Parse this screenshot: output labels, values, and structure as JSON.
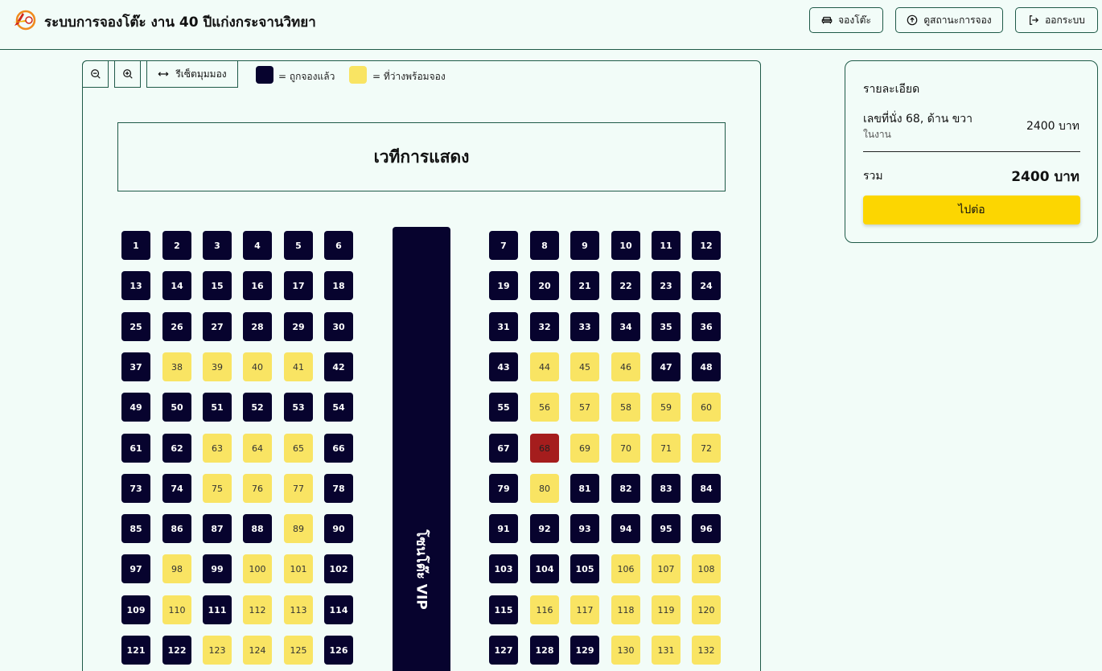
{
  "header": {
    "title": "ระบบการจองโต๊ะ งาน 40 ปีแก่งกระจานวิทยา",
    "buttons": {
      "book": "จองโต๊ะ",
      "status": "ดูสถานะการจอง",
      "logout": "ออกระบบ"
    }
  },
  "toolbar": {
    "reset_label": "รีเซ็ตมุมมอง",
    "legend_booked": "= ถูกจองแล้ว",
    "legend_available": "= ที่ว่างพร้อมจอง"
  },
  "stage_label": "เวทีการแสดง",
  "vip_label": "โซนโต๊ะ VIP",
  "colors": {
    "booked": "#07032e",
    "available": "#f9e463",
    "selected": "#a51d1d",
    "accent": "#fcd601",
    "border": "#1f5a48",
    "background": "#f2fcf8"
  },
  "seats": {
    "available": [
      38,
      39,
      40,
      41,
      44,
      45,
      46,
      56,
      57,
      58,
      59,
      60,
      63,
      64,
      65,
      69,
      70,
      71,
      72,
      75,
      76,
      77,
      80,
      89,
      98,
      100,
      101,
      106,
      107,
      108,
      110,
      112,
      113,
      116,
      117,
      118,
      119,
      120,
      123,
      124,
      125,
      130,
      131,
      132
    ],
    "selected": [
      68
    ],
    "total_visible": 132
  },
  "details": {
    "title": "รายละเอียด",
    "seat_text": "เลขที่นั่ง 68, ด้าน ขวา",
    "sub_text": "ในงาน",
    "price": "2400 บาท",
    "total_label": "รวม",
    "total": "2400 บาท",
    "continue_label": "ไปต่อ"
  }
}
